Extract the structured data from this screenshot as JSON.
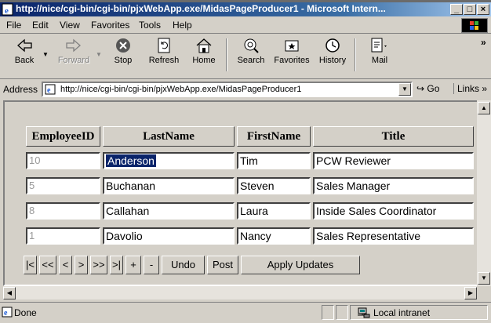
{
  "window": {
    "title": "http://nice/cgi-bin/cgi-bin/pjxWebApp.exe/MidasPageProducer1 - Microsoft Intern...",
    "controls": [
      "_",
      "□",
      "×"
    ]
  },
  "menu": [
    {
      "label": "File"
    },
    {
      "label": "Edit"
    },
    {
      "label": "View"
    },
    {
      "label": "Favorites"
    },
    {
      "label": "Tools"
    },
    {
      "label": "Help"
    }
  ],
  "toolbar": {
    "buttons": [
      {
        "label": "Back",
        "icon": "back-arrow-icon",
        "enabled": true
      },
      {
        "label": "Forward",
        "icon": "forward-arrow-icon",
        "enabled": false
      },
      {
        "label": "Stop",
        "icon": "stop-icon",
        "enabled": true
      },
      {
        "label": "Refresh",
        "icon": "refresh-icon",
        "enabled": true
      },
      {
        "label": "Home",
        "icon": "home-icon",
        "enabled": true
      },
      {
        "label": "Search",
        "icon": "search-icon",
        "enabled": true
      },
      {
        "label": "Favorites",
        "icon": "favorites-icon",
        "enabled": true
      },
      {
        "label": "History",
        "icon": "history-icon",
        "enabled": true
      },
      {
        "label": "Mail",
        "icon": "mail-icon",
        "enabled": true
      }
    ],
    "overflow": "»"
  },
  "address": {
    "label": "Address",
    "url": "http://nice/cgi-bin/cgi-bin/pjxWebApp.exe/MidasPageProducer1",
    "go_label": "Go",
    "links_label": "Links »"
  },
  "grid": {
    "columns": [
      "EmployeeID",
      "LastName",
      "FirstName",
      "Title"
    ],
    "rows": [
      {
        "id": "10",
        "last": "Anderson",
        "first": "Tim",
        "title": "PCW Reviewer"
      },
      {
        "id": "5",
        "last": "Buchanan",
        "first": "Steven",
        "title": "Sales Manager"
      },
      {
        "id": "8",
        "last": "Callahan",
        "first": "Laura",
        "title": "Inside Sales Coordinator"
      },
      {
        "id": "1",
        "last": "Davolio",
        "first": "Nancy",
        "title": "Sales Representative"
      }
    ]
  },
  "navigator": {
    "first": "|<",
    "prior_page": "<<",
    "prior": "<",
    "next": ">",
    "next_page": ">>",
    "last": ">|",
    "insert": "+",
    "delete": "-",
    "undo": "Undo",
    "post": "Post",
    "apply": "Apply Updates"
  },
  "status": {
    "text": "Done",
    "zone": "Local intranet"
  },
  "colors": {
    "titlebar": "#0a246a",
    "face": "#d4d0c8",
    "selection": "#0a246a"
  }
}
